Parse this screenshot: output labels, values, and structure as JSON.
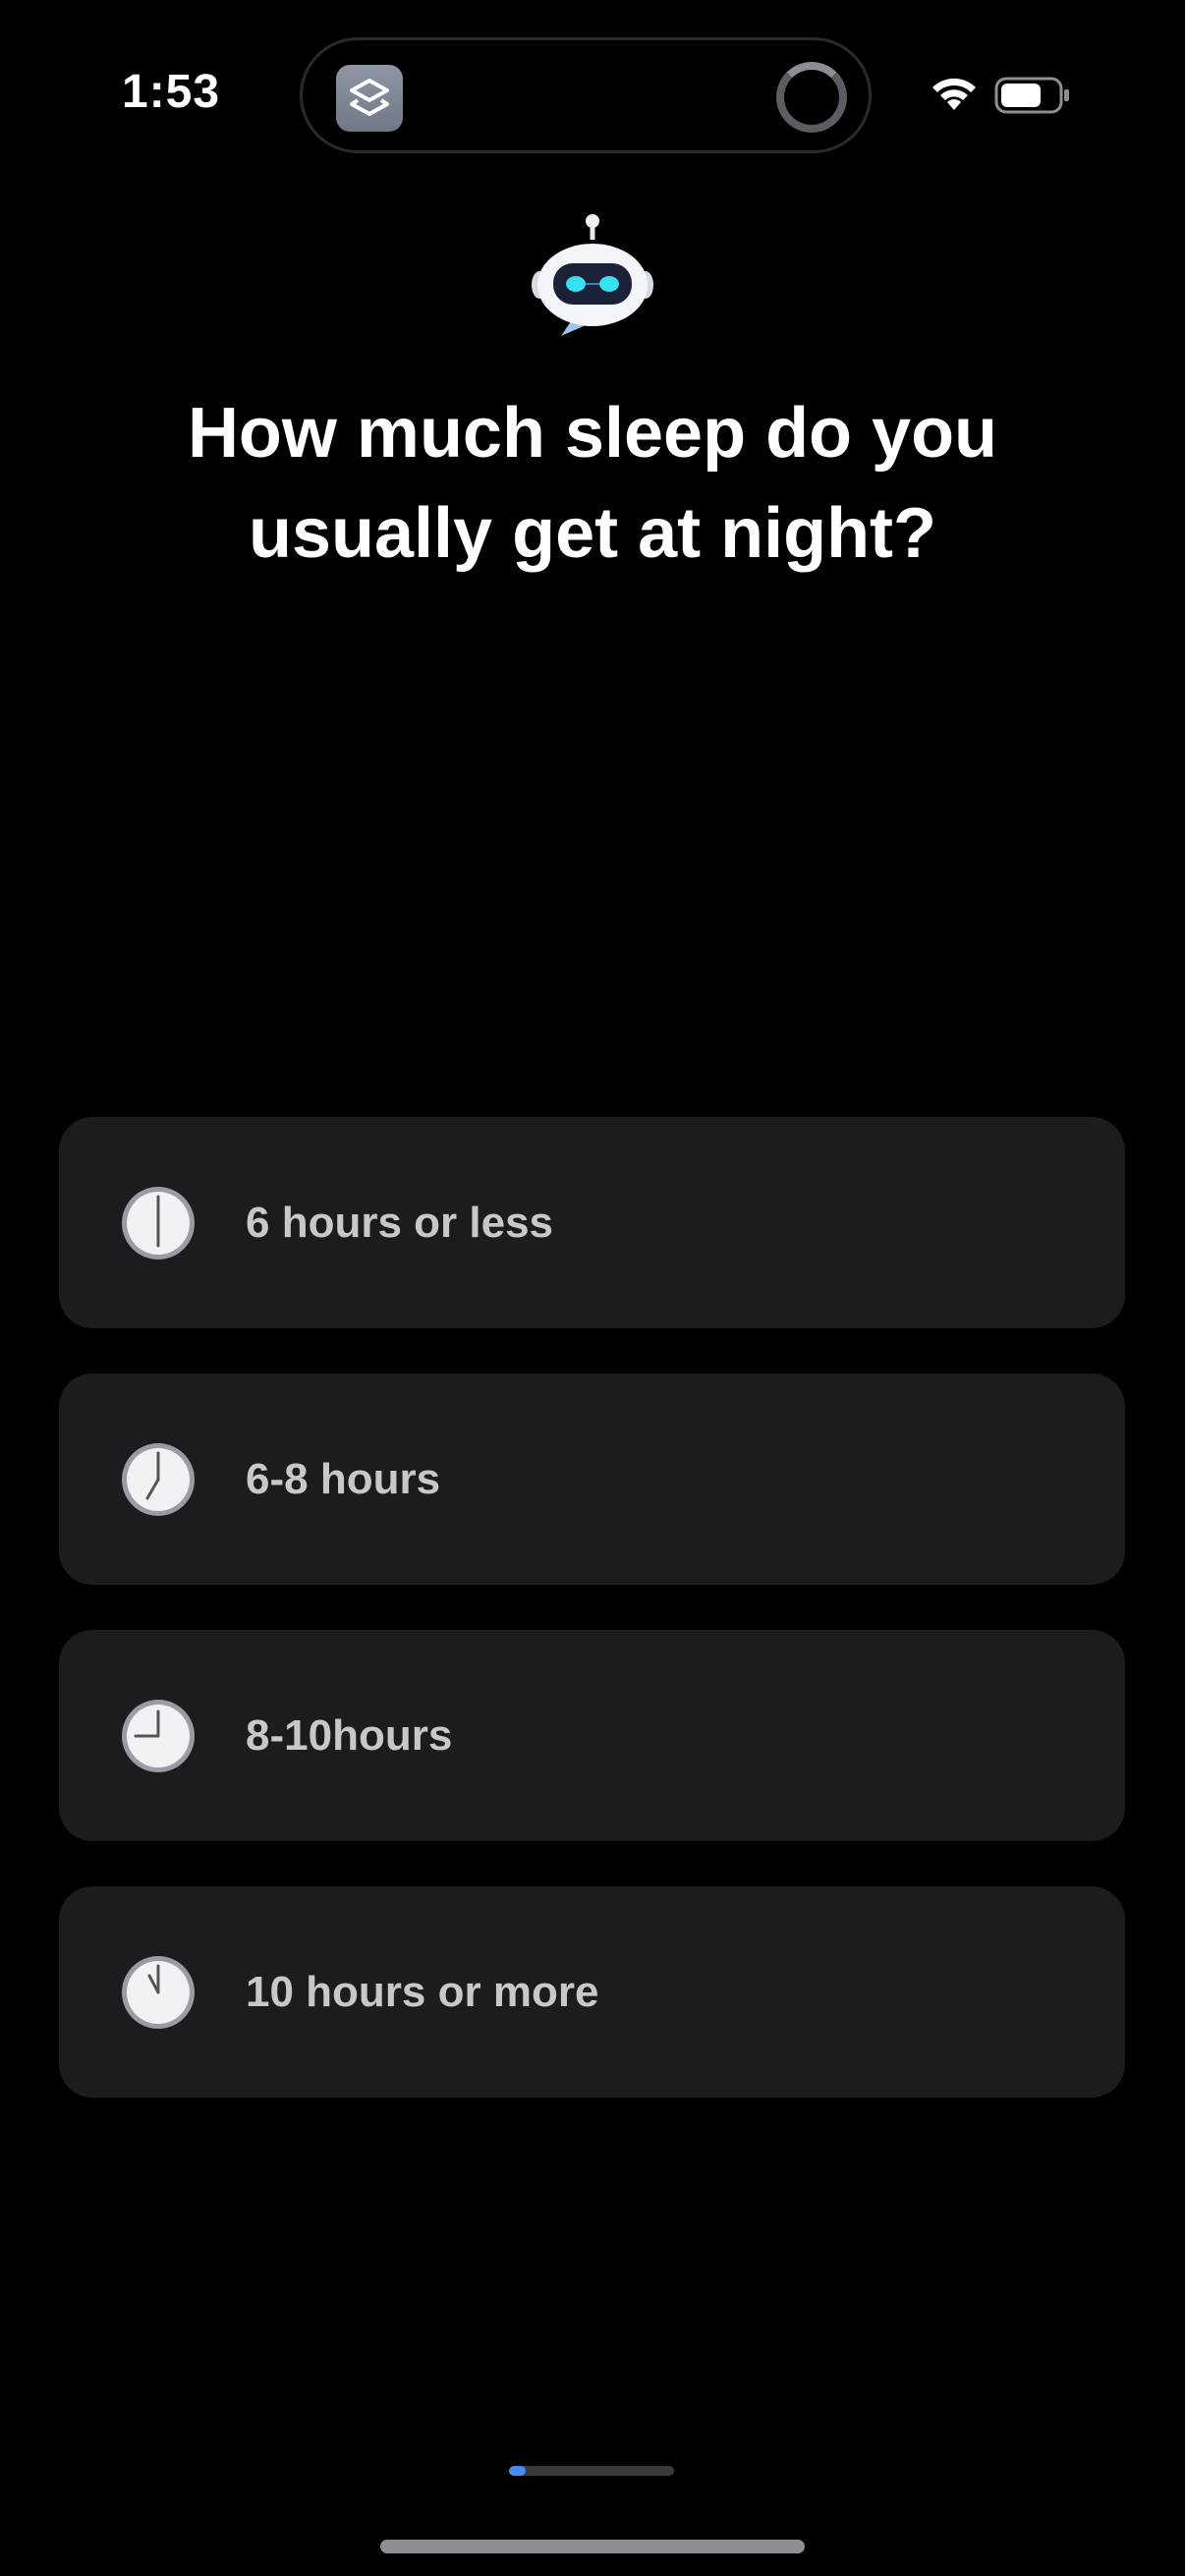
{
  "status_bar": {
    "time": "1:53"
  },
  "question": {
    "line1": "How much sleep do you",
    "line2": "usually get at night?"
  },
  "options": [
    {
      "label": "6 hours or less",
      "icon": "clock-six-icon"
    },
    {
      "label": "6-8 hours",
      "icon": "clock-seven-icon"
    },
    {
      "label": "8-10hours",
      "icon": "clock-nine-icon"
    },
    {
      "label": "10 hours or more",
      "icon": "clock-eleven-icon"
    }
  ],
  "progress": {
    "fraction": 0.1
  },
  "colors": {
    "background": "#000000",
    "card": "#1c1c1e",
    "option_text": "#c7c7cc",
    "accent": "#4a8cf7"
  }
}
